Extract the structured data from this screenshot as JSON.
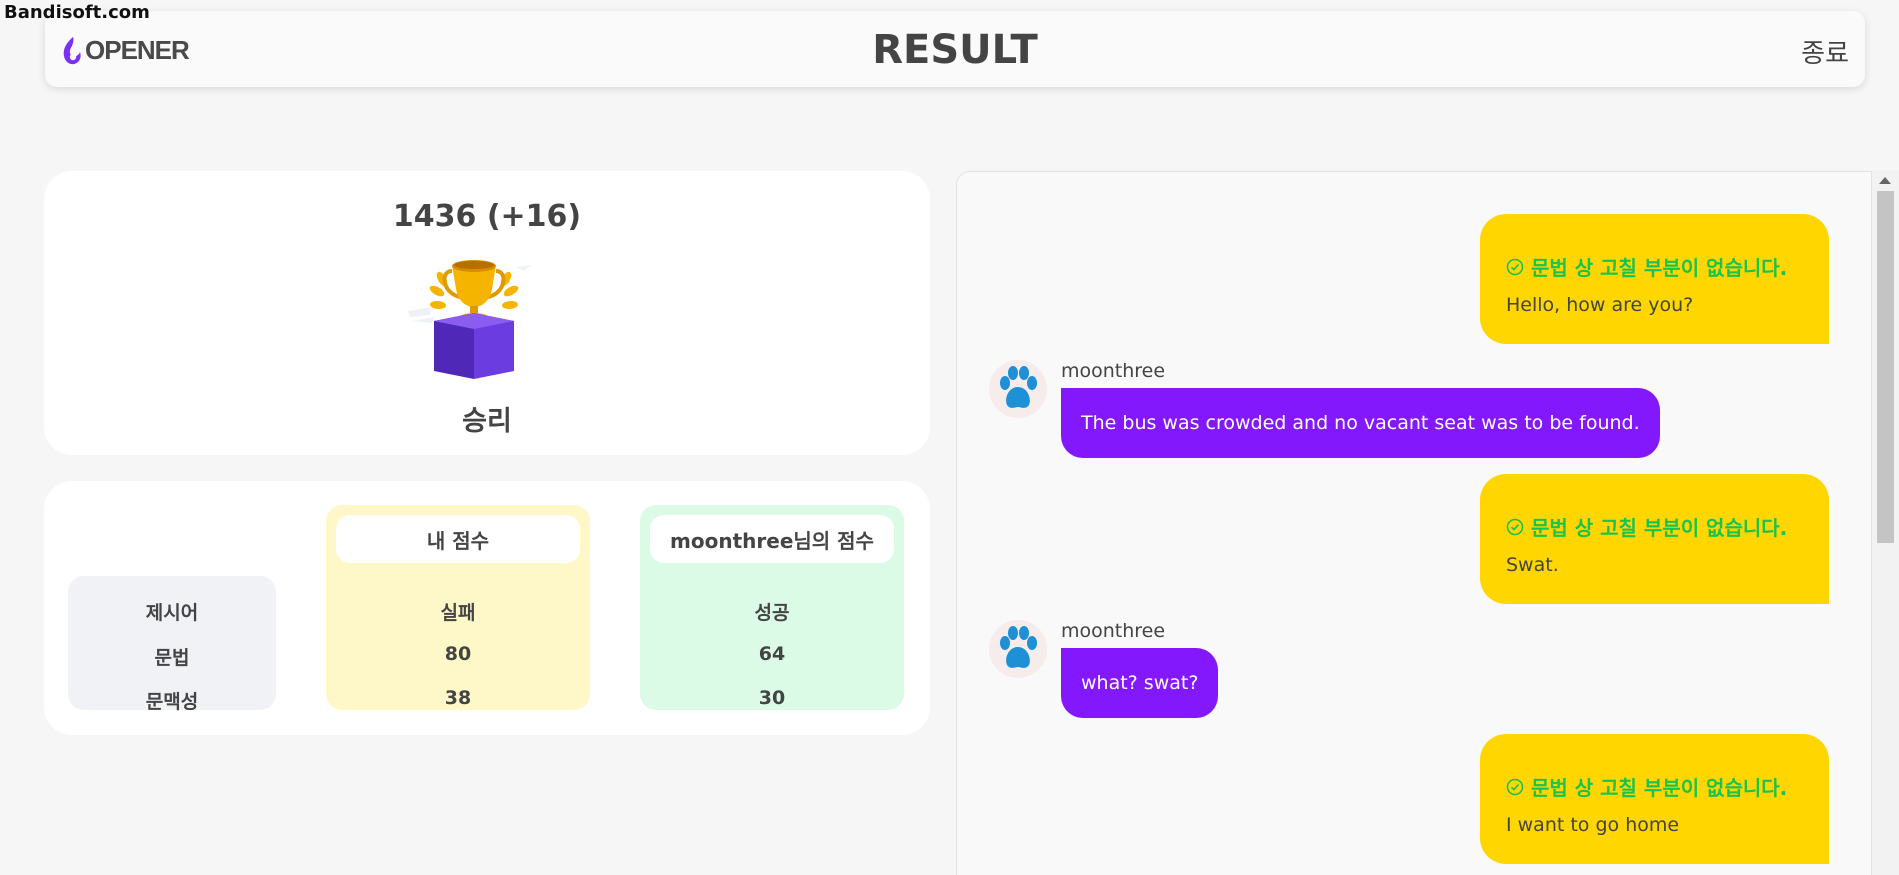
{
  "watermark": "Bandisoft.com",
  "header": {
    "logo_text": "OPENER",
    "title": "RESULT",
    "exit_label": "종료"
  },
  "result": {
    "rating": "1436 (+16)",
    "outcome": "승리"
  },
  "scores": {
    "row_labels": [
      "제시어",
      "문법",
      "문맥성"
    ],
    "mine": {
      "header": "내 점수",
      "values": [
        "실패",
        "80",
        "38"
      ]
    },
    "opponent": {
      "header": "moonthree님의 점수",
      "values": [
        "성공",
        "64",
        "30"
      ]
    }
  },
  "chat": {
    "messages": [
      {
        "from": "me",
        "check": "문법 상 고칠 부분이 없습니다.",
        "text": "Hello, how are you?"
      },
      {
        "from": "opponent",
        "name": "moonthree",
        "text": "The bus was crowded and no vacant seat was to be found."
      },
      {
        "from": "me",
        "check": "문법 상 고칠 부분이 없습니다.",
        "text": "Swat."
      },
      {
        "from": "opponent",
        "name": "moonthree",
        "text": "what? swat?"
      },
      {
        "from": "me",
        "check": "문법 상 고칠 부분이 없습니다.",
        "text": "I want to go home"
      }
    ]
  },
  "colors": {
    "my_bubble": "#ffd600",
    "opponent_bubble": "#8218fb",
    "check_green": "#19c34f",
    "logo_purple": "#7b2ff7"
  }
}
